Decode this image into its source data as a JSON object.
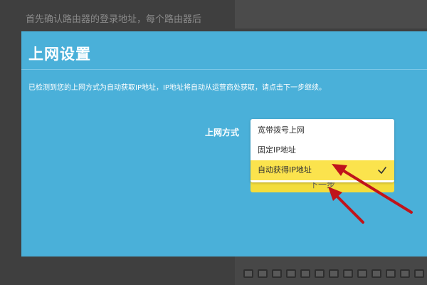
{
  "background": {
    "text": "首先确认路由器的登录地址，每个路由器后"
  },
  "modal": {
    "title": "上网设置",
    "description": "已检测到您的上网方式为自动获取IP地址，IP地址将自动从运营商处获取，请点击下一步继续。",
    "field_label": "上网方式",
    "next_label": "下一步",
    "options": [
      {
        "label": "宽带拨号上网",
        "selected": false
      },
      {
        "label": "固定IP地址",
        "selected": false
      },
      {
        "label": "自动获得IP地址",
        "selected": true
      }
    ]
  },
  "icons": {
    "check": "check-icon",
    "annotation": "red-arrow-icon"
  },
  "colors": {
    "modal_bg": "#4ab0d9",
    "selected_bg": "#fbe34d",
    "button_bg": "#f3dd3c",
    "arrow": "#c0141b"
  }
}
